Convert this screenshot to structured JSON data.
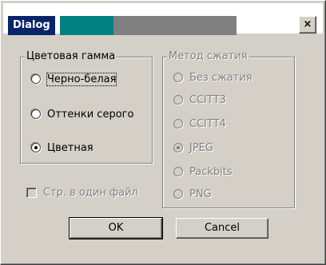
{
  "window": {
    "title": "Dialog",
    "close_glyph": "×",
    "colors": {
      "title_active": "#0a246a",
      "title_teal": "#008080",
      "title_gray": "#808080",
      "face": "#d4d0c8"
    }
  },
  "color_group": {
    "title": "Цветовая гамма",
    "options": [
      {
        "label": "Черно-белая",
        "selected": false
      },
      {
        "label": "Оттенки серого",
        "selected": false
      },
      {
        "label": "Цветная",
        "selected": true
      }
    ]
  },
  "compression_group": {
    "title": "Метод сжатия",
    "disabled": true,
    "options": [
      {
        "label": "Без сжатия",
        "selected": false
      },
      {
        "label": "CCITT3",
        "selected": false
      },
      {
        "label": "CCITT4",
        "selected": false
      },
      {
        "label": "JPEG",
        "selected": true
      },
      {
        "label": "Packbits",
        "selected": false
      },
      {
        "label": "PNG",
        "selected": false
      }
    ]
  },
  "single_file_checkbox": {
    "label": "Стр. в один файл",
    "checked": false,
    "disabled": true
  },
  "buttons": {
    "ok": "OK",
    "cancel": "Cancel"
  }
}
